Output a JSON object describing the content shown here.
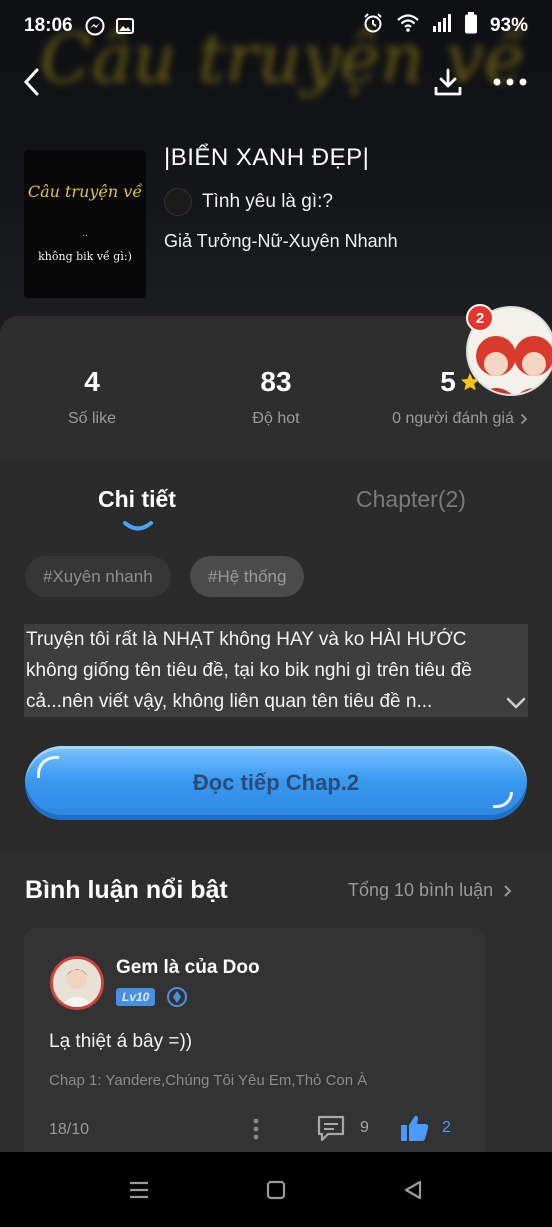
{
  "status_bar": {
    "time": "18:06",
    "battery": "93%",
    "icons": [
      "messenger-icon",
      "gallery-icon",
      "alarm-icon",
      "wifi-icon",
      "signal-icon",
      "battery-icon"
    ]
  },
  "header": {
    "watermark_text": "Câu truyện về",
    "book_title": "|BIỂN XANH ĐẸP|",
    "author": "Tình yêu là gì:?",
    "genres": "Giả Tưởng-Nữ-Xuyên Nhanh",
    "cover": {
      "title": "Câu truyện về",
      "dots": "..",
      "subtitle": "không bik về gì:)"
    }
  },
  "stats": {
    "likes": {
      "value": "4",
      "label": "Số like"
    },
    "hot": {
      "value": "83",
      "label": "Độ hot"
    },
    "rating": {
      "value": "5",
      "label": "0 người đánh giá"
    },
    "notification_count": "2"
  },
  "tabs": [
    {
      "label": "Chi tiết",
      "active": true
    },
    {
      "label": "Chapter(2)",
      "active": false
    }
  ],
  "tags": [
    "#Xuyên nhanh",
    "#Hệ thống"
  ],
  "description": "Truyện tôi rất là NHẠT không HAY và ko HÀI HƯỚC không giống tên tiêu đề, tại ko bik nghi gì trên tiêu đề cả...nên viết vậy, không liên quan tên tiêu đề n...",
  "read_button": "Đọc tiếp Chap.2",
  "comments": {
    "title": "Bình luận nổi bật",
    "total": "Tổng 10 bình luận",
    "items": [
      {
        "user": "Gem là của Doo",
        "level": "Lv10",
        "text": "Lạ thiệt á bây =))",
        "chapter": "Chap 1: Yandere,Chúng Tôi Yêu Em,Thỏ Con À",
        "date": "18/10",
        "replies": "9",
        "likes": "2"
      }
    ]
  },
  "colors": {
    "accent_blue": "#3b9af0",
    "star": "#f5c518",
    "badge_red": "#e8352c",
    "background": "#262626"
  }
}
